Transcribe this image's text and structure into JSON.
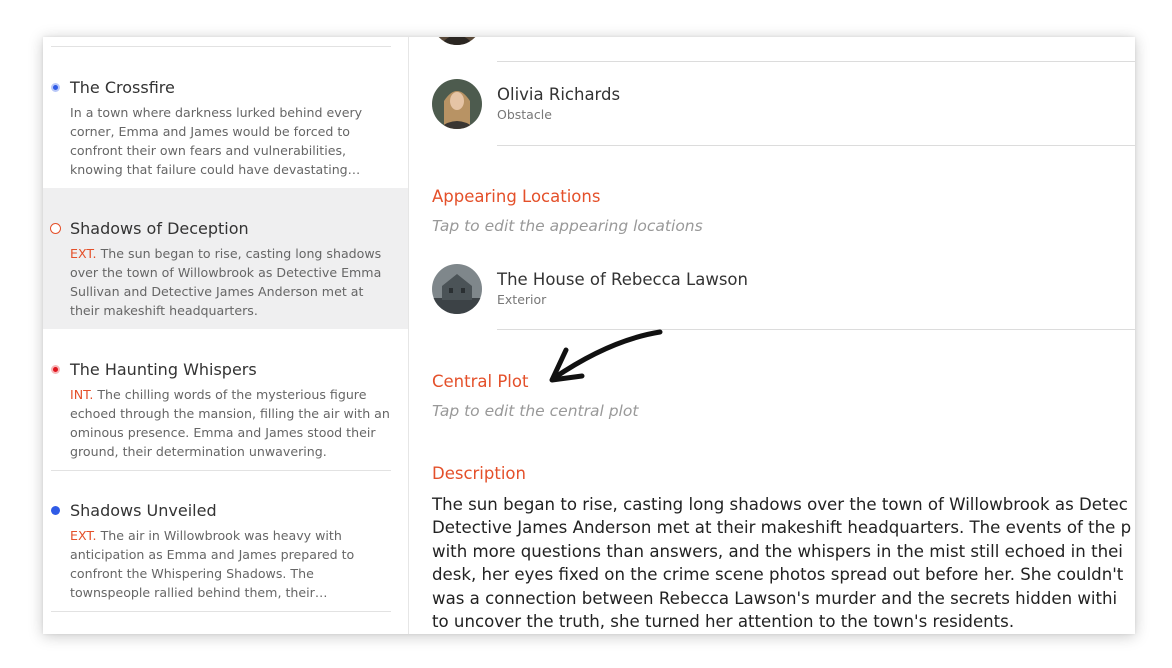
{
  "sidebar": {
    "scenes": [
      {
        "title": "The Crossfire",
        "tag": "",
        "text": "In a town where darkness lurked behind every corner, Emma and James would be forced to confront their own fears and vulnerabilities, knowing that failure could have devastating consequences.",
        "dot_color": "#2f5be6",
        "dot_style": "filled-ring"
      },
      {
        "title": "Shadows of Deception",
        "tag": "EXT.",
        "text": "The sun began to rise, casting long shadows over the town of Willowbrook as Detective Emma Sullivan and Detective James Anderson met at their makeshift headquarters.",
        "dot_color": "#e4502a",
        "dot_style": "hollow"
      },
      {
        "title": "The Haunting Whispers",
        "tag": "INT.",
        "text": "The chilling words of the mysterious figure echoed through the mansion, filling the air with an ominous presence. Emma and James stood their ground, their determination unwavering.",
        "dot_color": "#e0141e",
        "dot_style": "filled-ring"
      },
      {
        "title": "Shadows Unveiled",
        "tag": "EXT.",
        "text": "The air in Willowbrook was heavy with anticipation as Emma and James prepared to confront the Whispering Shadows. The townspeople rallied behind them, their determination evident.",
        "dot_color": "#2f5be6",
        "dot_style": "filled"
      }
    ]
  },
  "main": {
    "characters": [
      {
        "name": "Olivia Richards",
        "role": "Obstacle"
      }
    ],
    "locations_section": {
      "heading": "Appearing Locations",
      "hint": "Tap to edit the appearing locations"
    },
    "locations": [
      {
        "name": "The House of Rebecca Lawson",
        "type": "Exterior"
      }
    ],
    "central_plot": {
      "heading": "Central Plot",
      "hint": "Tap to edit the central plot"
    },
    "description": {
      "heading": "Description",
      "lines": [
        "The sun began to rise, casting long shadows over the town of Willowbrook as Detec",
        "Detective James Anderson met at their makeshift headquarters. The events of the p",
        "with more questions than answers, and the whispers in the mist still echoed in thei",
        "desk, her eyes fixed on the crime scene photos spread out before her. She couldn't",
        "was a connection between Rebecca Lawson's murder and the secrets hidden withi",
        "to uncover the truth, she turned her attention to the town's residents."
      ]
    }
  },
  "colors": {
    "accent": "#e4502a",
    "selected_bg": "#efeff0"
  }
}
